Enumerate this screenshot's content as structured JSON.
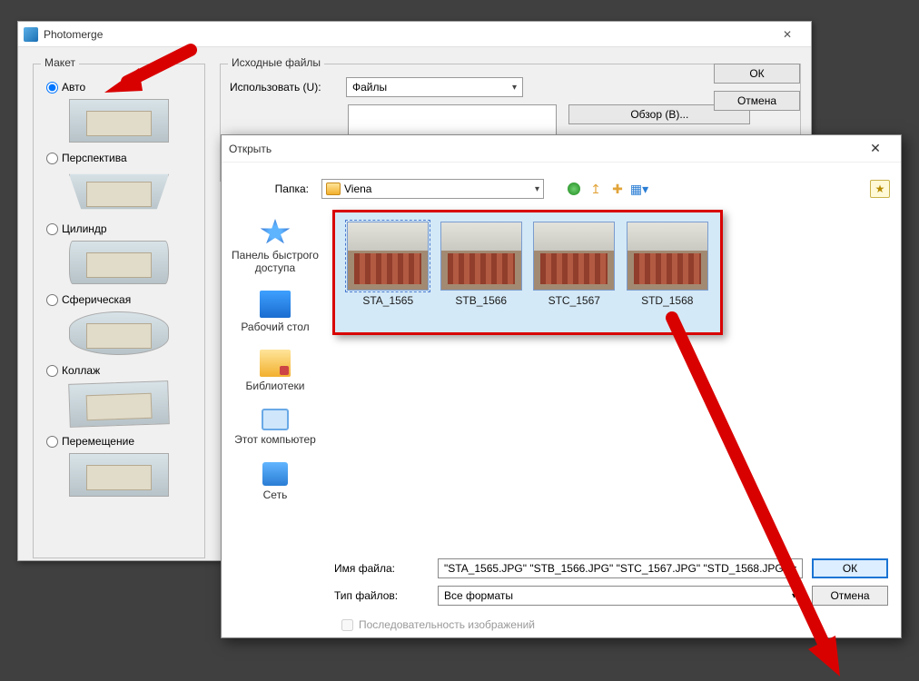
{
  "photomerge": {
    "title": "Photomerge",
    "layout_legend": "Макет",
    "source_legend": "Исходные файлы",
    "use_label": "Использовать (U):",
    "use_value": "Файлы",
    "browse_label": "Обзор (B)...",
    "ok": "ОК",
    "cancel": "Отмена",
    "radios": {
      "auto": "Авто",
      "perspective": "Перспектива",
      "cylinder": "Цилиндр",
      "spherical": "Сферическая",
      "collage": "Коллаж",
      "reposition": "Перемещение"
    }
  },
  "open": {
    "title": "Открыть",
    "folder_label": "Папка:",
    "folder_value": "Viena",
    "places": {
      "quick": "Панель быстрого доступа",
      "desktop": "Рабочий стол",
      "libs": "Библиотеки",
      "pc": "Этот компьютер",
      "net": "Сеть"
    },
    "thumbs": [
      "STA_1565",
      "STB_1566",
      "STC_1567",
      "STD_1568"
    ],
    "filename_label": "Имя файла:",
    "filename_value": "\"STA_1565.JPG\" \"STB_1566.JPG\" \"STC_1567.JPG\" \"STD_1568.JPG\"",
    "filetype_label": "Тип файлов:",
    "filetype_value": "Все форматы",
    "ok": "ОК",
    "cancel": "Отмена",
    "sequence": "Последовательность изображений"
  }
}
